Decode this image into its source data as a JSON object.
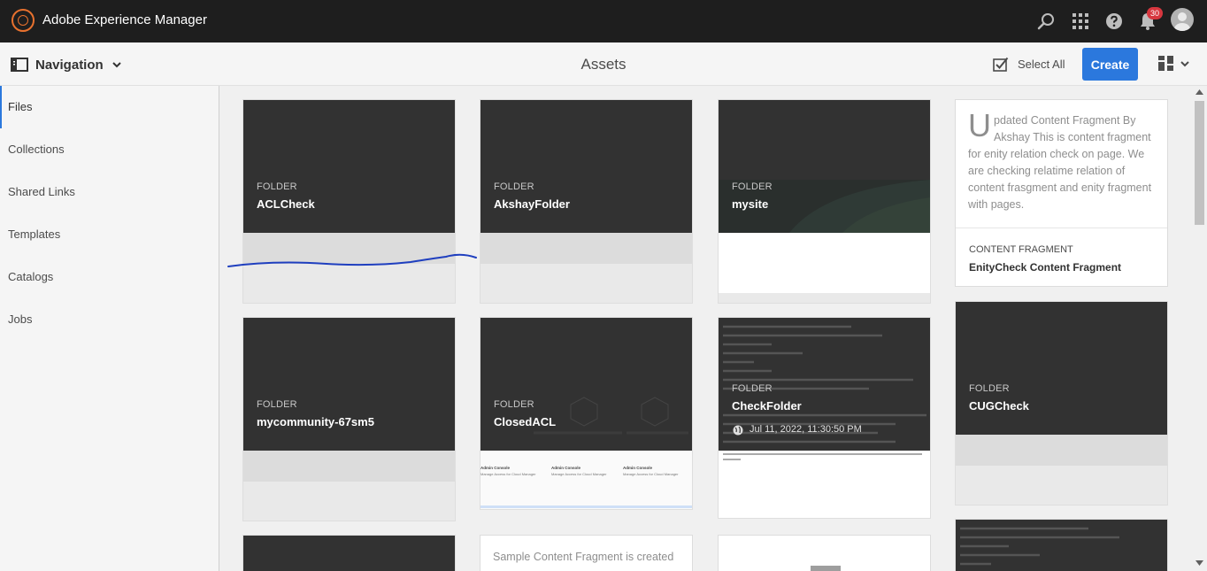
{
  "shell": {
    "app_title": "Adobe Experience Manager",
    "notification_count": "30",
    "icons": [
      "search-icon",
      "apps-grid-icon",
      "help-icon",
      "bell-icon",
      "user-avatar"
    ]
  },
  "actionbar": {
    "nav_label": "Navigation",
    "page_title": "Assets",
    "select_all": "Select All",
    "create": "Create"
  },
  "rail": {
    "items": [
      "Files",
      "Collections",
      "Shared Links",
      "Templates",
      "Catalogs",
      "Jobs"
    ]
  },
  "cards": {
    "aclcheck": {
      "kind": "FOLDER",
      "name": "ACLCheck"
    },
    "akshay": {
      "kind": "FOLDER",
      "name": "AkshayFolder"
    },
    "mysite": {
      "kind": "FOLDER",
      "name": "mysite"
    },
    "entity": {
      "dropcap": "U",
      "text": "pdated Content Fragment By Akshay This is content fragment for enity relation check on page. We are checking relatime relation of content frasgment and enity fragment with pages.",
      "kind": "CONTENT FRAGMENT",
      "name": "EnityCheck Content Fragment"
    },
    "mycommunity": {
      "kind": "FOLDER",
      "name": "mycommunity-67sm5"
    },
    "closedacl": {
      "kind": "FOLDER",
      "name": "ClosedACL",
      "console_title": "Admin Console",
      "console_sub": "Manage Access for Cloud Manager"
    },
    "checkfolder": {
      "kind": "FOLDER",
      "name": "CheckFolder",
      "date": "Jul 11, 2022, 11:30:50 PM"
    },
    "cugcheck": {
      "kind": "FOLDER",
      "name": "CUGCheck"
    },
    "sample": {
      "text": "Sample Content Fragment is created"
    }
  },
  "colors": {
    "accent": "#2b78dd",
    "shell_bg": "#1e1e1e",
    "thumb_bg": "#323232",
    "logo": "#e8712e",
    "badge": "#d7373f",
    "annotation": "#1f3fbf"
  }
}
